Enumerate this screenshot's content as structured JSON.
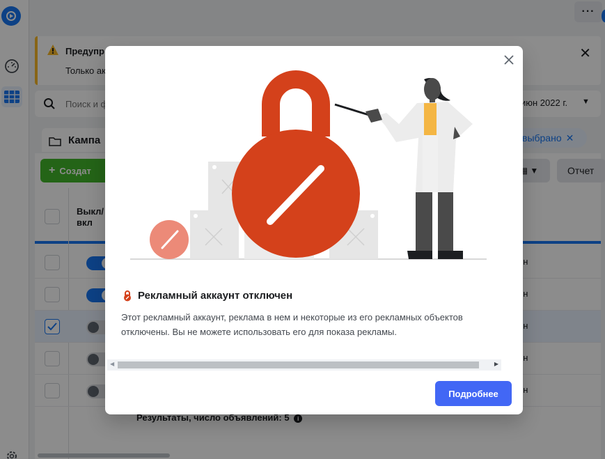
{
  "rail": {
    "logo_icon": "ads-manager-logo-icon",
    "items": [
      {
        "icon": "dashboard-gauge-icon"
      },
      {
        "icon": "table-grid-icon"
      },
      {
        "icon": "settings-gear-icon"
      }
    ]
  },
  "topbar": {
    "more_label": "···"
  },
  "warning": {
    "title": "Предупр",
    "text": "Только ак",
    "close": "✕"
  },
  "search": {
    "placeholder": "Поиск и ф",
    "date_range": "июн 2022 г."
  },
  "tabs": {
    "campaigns_label": "Кампа",
    "selected_chip": "выбрано"
  },
  "toolbar": {
    "create_label": "Создат",
    "report_label": "Отчет"
  },
  "table": {
    "toggle_header_line1": "Выкл/",
    "toggle_header_line2": "вкл",
    "rows": [
      {
        "checked": false,
        "on": true,
        "status": "ен"
      },
      {
        "checked": false,
        "on": true,
        "status": "ен"
      },
      {
        "checked": true,
        "on": false,
        "status": "ен"
      },
      {
        "checked": false,
        "on": false,
        "status": "ен"
      },
      {
        "checked": false,
        "on": false,
        "status": "ен"
      }
    ],
    "results_label": "Результаты, число объявлений: 5"
  },
  "modal": {
    "title": "Рекламный аккаунт отключен",
    "body": "Этот рекламный аккаунт, реклама в нем и некоторые из его рекламных объектов отключены. Вы не можете использовать его для показа рекламы.",
    "learn_more": "Подробнее",
    "accent_color": "#d4411b",
    "button_color": "#4267f5"
  }
}
